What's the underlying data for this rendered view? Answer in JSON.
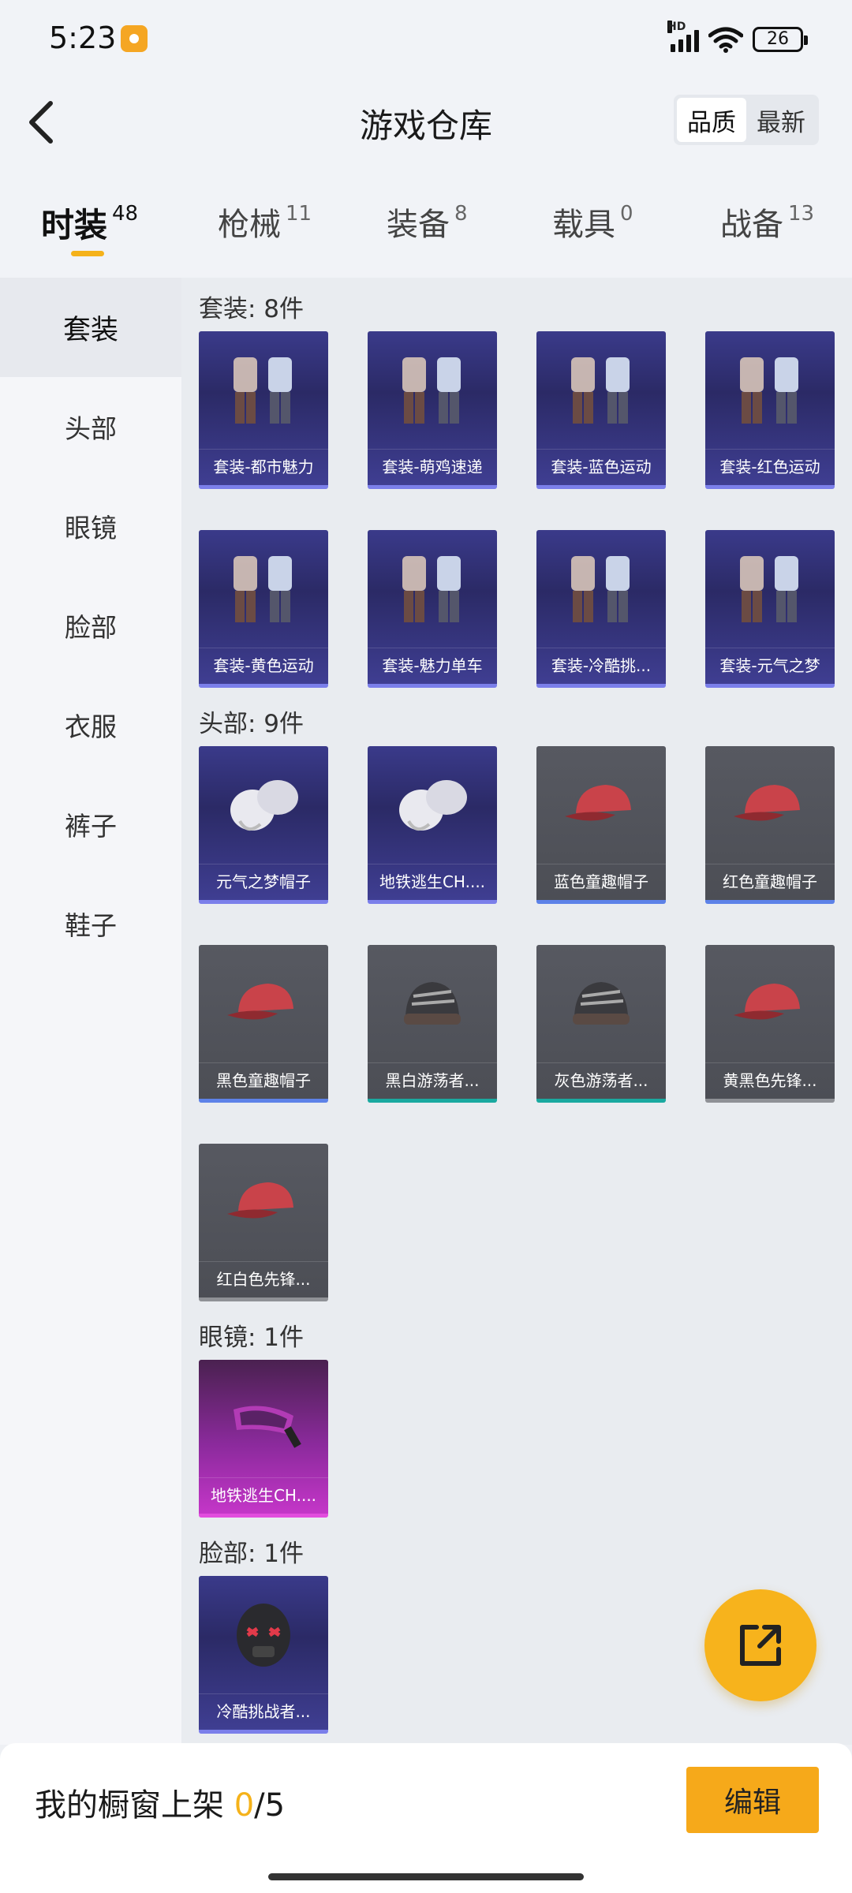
{
  "status_bar": {
    "time": "5:23",
    "battery": "26",
    "network": "HD"
  },
  "header": {
    "title": "游戏仓库",
    "sort_options": [
      "品质",
      "最新"
    ],
    "active_sort": "品质"
  },
  "category_tabs": [
    {
      "label": "时装",
      "count": "48"
    },
    {
      "label": "枪械",
      "count": "11"
    },
    {
      "label": "装备",
      "count": "8"
    },
    {
      "label": "载具",
      "count": "0"
    },
    {
      "label": "战备",
      "count": "13"
    }
  ],
  "sidebar": {
    "items": [
      "套装",
      "头部",
      "眼镜",
      "脸部",
      "衣服",
      "裤子",
      "鞋子"
    ]
  },
  "sections": [
    {
      "title": "套装: 8件",
      "items": [
        {
          "name": "套装-都市魅力",
          "rarity": "purple",
          "icon": "suit-icon"
        },
        {
          "name": "套装-萌鸡速递",
          "rarity": "purple",
          "icon": "suit-icon"
        },
        {
          "name": "套装-蓝色运动",
          "rarity": "purple",
          "icon": "suit-icon"
        },
        {
          "name": "套装-红色运动",
          "rarity": "purple",
          "icon": "suit-icon"
        },
        {
          "name": "套装-黄色运动",
          "rarity": "purple",
          "icon": "suit-icon"
        },
        {
          "name": "套装-魅力单车",
          "rarity": "purple",
          "icon": "suit-icon"
        },
        {
          "name": "套装-冷酷挑...",
          "rarity": "purple",
          "icon": "suit-icon"
        },
        {
          "name": "套装-元气之梦",
          "rarity": "purple",
          "icon": "suit-icon"
        }
      ]
    },
    {
      "title": "头部: 9件",
      "items": [
        {
          "name": "元气之梦帽子",
          "rarity": "purple",
          "icon": "hair-icon"
        },
        {
          "name": "地铁逃生CH....",
          "rarity": "purple",
          "icon": "hair-icon"
        },
        {
          "name": "蓝色童趣帽子",
          "rarity": "blue",
          "icon": "cap-icon"
        },
        {
          "name": "红色童趣帽子",
          "rarity": "blue",
          "icon": "cap-icon"
        },
        {
          "name": "黑色童趣帽子",
          "rarity": "blue",
          "icon": "cap-icon"
        },
        {
          "name": "黑白游荡者...",
          "rarity": "teal",
          "icon": "beanie-icon"
        },
        {
          "name": "灰色游荡者...",
          "rarity": "teal",
          "icon": "beanie-icon"
        },
        {
          "name": "黄黑色先锋...",
          "rarity": "gray",
          "icon": "cap-icon"
        },
        {
          "name": "红白色先锋...",
          "rarity": "gray",
          "icon": "cap-icon"
        }
      ]
    },
    {
      "title": "眼镜: 1件",
      "items": [
        {
          "name": "地铁逃生CH....",
          "rarity": "pink",
          "icon": "goggles-icon"
        }
      ]
    },
    {
      "title": "脸部: 1件",
      "items": [
        {
          "name": "冷酷挑战者...",
          "rarity": "purple",
          "icon": "mask-icon"
        }
      ]
    }
  ],
  "bottom_bar": {
    "label": "我的橱窗上架",
    "count": "0",
    "total": "/5",
    "edit_label": "编辑"
  },
  "colors": {
    "accent": "#f5b21a",
    "button": "#f6a91a",
    "purple_card": "#2b2a66",
    "gray_card": "#4c4e55"
  }
}
